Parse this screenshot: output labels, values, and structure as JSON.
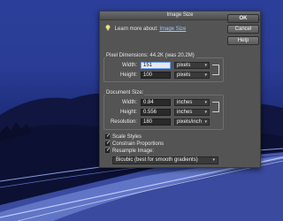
{
  "dialog": {
    "title": "Image Size",
    "learn_prefix": "Learn more about:",
    "learn_link": "Image Size"
  },
  "buttons": {
    "ok": "OK",
    "cancel": "Cancel",
    "help": "Help"
  },
  "pixel_dimensions": {
    "label": "Pixel Dimensions:",
    "size": "44.2K (was 20.2M)",
    "width_label": "Width:",
    "width_value": "151",
    "width_unit": "pixels",
    "height_label": "Height:",
    "height_value": "100",
    "height_unit": "pixels"
  },
  "document_size": {
    "label": "Document Size:",
    "width_label": "Width:",
    "width_value": "0.84",
    "width_unit": "inches",
    "height_label": "Height:",
    "height_value": "0.556",
    "height_unit": "inches",
    "resolution_label": "Resolution:",
    "resolution_value": "180",
    "resolution_unit": "pixels/inch"
  },
  "options": {
    "scale_styles": "Scale Styles",
    "constrain": "Constrain Proportions",
    "resample": "Resample Image:",
    "method": "Bicubic (best for smooth gradients)"
  },
  "colors": {
    "dialog_bg": "#545454",
    "link": "#9ec8ff",
    "sky": "#2b3f9a"
  }
}
